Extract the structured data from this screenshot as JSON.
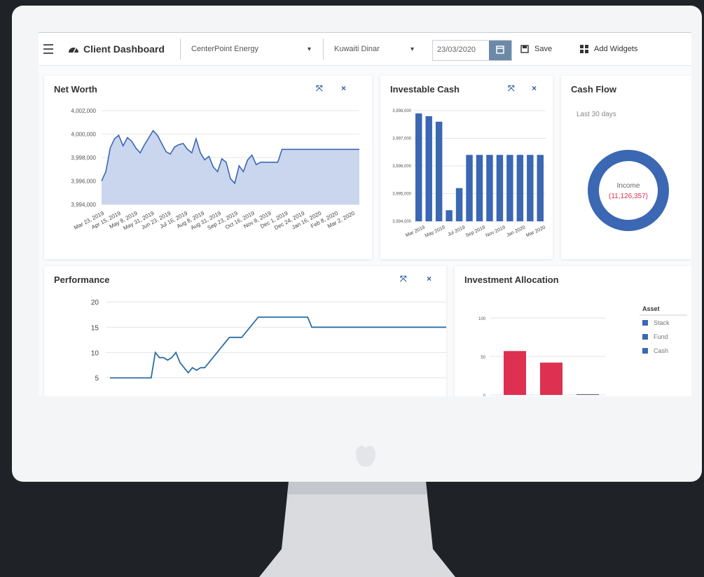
{
  "header": {
    "title": "Client Dashboard",
    "company_select": "CenterPoint Energy",
    "currency_select": "Kuwaiti Dinar",
    "date_value": "23/03/2020",
    "save_label": "Save",
    "add_widgets_label": "Add Widgets"
  },
  "panels": {
    "net_worth": {
      "title": "Net Worth"
    },
    "investable_cash": {
      "title": "Investable Cash"
    },
    "cash_flow": {
      "title": "Cash Flow",
      "subtitle": "Last 30 days",
      "center_label": "Income",
      "center_value": "(11,126,357)"
    },
    "performance": {
      "title": "Performance"
    },
    "investment_allocation": {
      "title": "Investment Allocation",
      "legend_title": "Asset"
    }
  },
  "chart_data": [
    {
      "type": "area",
      "title": "Net Worth",
      "y_ticks": [
        "3,994,000",
        "3,996,000",
        "3,998,000",
        "4,000,000",
        "4,002,000"
      ],
      "ylim": [
        3994000,
        4002000
      ],
      "x_ticks": [
        "Mar 23, 2019",
        "Apr 15, 2019",
        "May 8, 2019",
        "May 31, 2019",
        "Jun 23, 2019",
        "Jul 16, 2019",
        "Aug 8, 2019",
        "Aug 31, 2019",
        "Sep 23, 2019",
        "Oct 16, 2019",
        "Nov 8, 2019",
        "Dec 1, 2019",
        "Dec 24, 2019",
        "Jan 16, 2020",
        "Feb 8, 2020",
        "Mar 2, 2020"
      ],
      "values": [
        3996000,
        3996800,
        3998800,
        3999600,
        3999900,
        3999000,
        3999700,
        3999400,
        3998800,
        3998400,
        3999100,
        3999700,
        4000300,
        3999900,
        3999200,
        3998500,
        3998300,
        3998900,
        3999100,
        3999200,
        3998700,
        3998400,
        3999600,
        3998400,
        3997800,
        3998100,
        3997200,
        3996800,
        3997900,
        3997600,
        3996200,
        3995800,
        3997300,
        3996800,
        3997800,
        3998200,
        3997400,
        3997600,
        3997600,
        3997600,
        3997600,
        3997600,
        3998700,
        3998700,
        3998700,
        3998700,
        3998700,
        3998700,
        3998700,
        3998700,
        3998700,
        3998700,
        3998700,
        3998700,
        3998700,
        3998700,
        3998700,
        3998700,
        3998700,
        3998700,
        3998700
      ]
    },
    {
      "type": "bar",
      "title": "Investable Cash",
      "y_ticks": [
        "3,994,000",
        "3,995,000",
        "3,996,000",
        "3,997,000",
        "3,998,000"
      ],
      "ylim": [
        3994000,
        3998000
      ],
      "x_ticks": [
        "Mar 2019",
        "May 2019",
        "Jul 2019",
        "Sep 2019",
        "Nov 2019",
        "Jan 2020",
        "Mar 2020"
      ],
      "values": [
        3997900,
        3997800,
        3997600,
        3994400,
        3995200,
        3996400,
        3996400,
        3996400,
        3996400,
        3996400,
        3996400,
        3996400,
        3996400
      ]
    },
    {
      "type": "pie",
      "title": "Cash Flow",
      "slices": [
        {
          "name": "Income",
          "value": 100
        }
      ]
    },
    {
      "type": "line",
      "title": "Performance",
      "y_ticks": [
        "5",
        "10",
        "15",
        "20"
      ],
      "ylim": [
        3,
        21
      ],
      "values": [
        5,
        5,
        5,
        5,
        5,
        5,
        5,
        5,
        5,
        5,
        5,
        10,
        9,
        9,
        8.5,
        9,
        10,
        8,
        7,
        6,
        7,
        6.5,
        7,
        7,
        8,
        9,
        10,
        11,
        12,
        13,
        13,
        13,
        13,
        14,
        15,
        16,
        17,
        17,
        17,
        17,
        17,
        17,
        17,
        17,
        17,
        17,
        17,
        17,
        17,
        15,
        15,
        15,
        15,
        15,
        15,
        15,
        15,
        15,
        15,
        15,
        15,
        15,
        15,
        15,
        15,
        15,
        15,
        15,
        15,
        15,
        15,
        15,
        15,
        15,
        15,
        15,
        15,
        15,
        15,
        15,
        15,
        15,
        15,
        15
      ]
    },
    {
      "type": "bar",
      "title": "Investment Allocation",
      "y_ticks": [
        "0",
        "50",
        "100"
      ],
      "ylim": [
        0,
        100
      ],
      "series": [
        {
          "name": "Stack"
        },
        {
          "name": "Fund"
        },
        {
          "name": "Cash"
        }
      ],
      "values": [
        57,
        42,
        1
      ]
    }
  ],
  "colors": {
    "primary": "#3b67b3",
    "accent_red": "#de3050",
    "area_fill": "#c9d6ee",
    "header_bg": "#ffffff"
  },
  "icons": {
    "menu": "menu-icon",
    "dashboard": "dashboard-icon",
    "calendar": "calendar-icon",
    "save": "save-icon",
    "widgets": "widgets-icon",
    "expand": "expand-icon",
    "close": "close-icon"
  }
}
